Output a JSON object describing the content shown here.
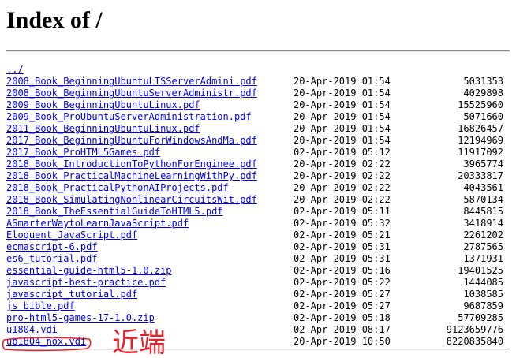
{
  "page": {
    "title": "Index of /",
    "parent_link": "../"
  },
  "files": [
    {
      "name": "2008_Book_BeginningUbuntuLTSServerAdmini.pdf",
      "date": "20-Apr-2019 01:54",
      "size": "5031353"
    },
    {
      "name": "2008_Book_BeginningUbuntuServerAdministr.pdf",
      "date": "20-Apr-2019 01:54",
      "size": "4029898"
    },
    {
      "name": "2009_Book_BeginningUbuntuLinux.pdf",
      "date": "20-Apr-2019 01:54",
      "size": "15525960"
    },
    {
      "name": "2009_Book_ProUbuntuServerAdministration.pdf",
      "date": "20-Apr-2019 01:54",
      "size": "5071660"
    },
    {
      "name": "2011_Book_BeginningUbuntuLinux.pdf",
      "date": "20-Apr-2019 01:54",
      "size": "16826457"
    },
    {
      "name": "2017_Book_BeginningUbuntuForWindowsAndMa.pdf",
      "date": "20-Apr-2019 01:54",
      "size": "12194969"
    },
    {
      "name": "2017_Book_ProHTML5Games.pdf",
      "date": "02-Apr-2019 05:12",
      "size": "11917092"
    },
    {
      "name": "2018_Book_IntroductionToPythonForEnginee.pdf",
      "date": "20-Apr-2019 02:22",
      "size": "3965774"
    },
    {
      "name": "2018_Book_PracticalMachineLearningWithPy.pdf",
      "date": "20-Apr-2019 02:22",
      "size": "20333817"
    },
    {
      "name": "2018_Book_PracticalPythonAIProjects.pdf",
      "date": "20-Apr-2019 02:22",
      "size": "4043561"
    },
    {
      "name": "2018_Book_SimulatingNonlinearCircuitsWit.pdf",
      "date": "20-Apr-2019 02:22",
      "size": "5870134"
    },
    {
      "name": "2018_Book_TheEssentialGuideToHTML5.pdf",
      "date": "02-Apr-2019 05:11",
      "size": "8445815"
    },
    {
      "name": "ASmarterWaytoLearnJavaScript.pdf",
      "date": "02-Apr-2019 05:32",
      "size": "3418914"
    },
    {
      "name": "Eloquent_JavaScript.pdf",
      "date": "02-Apr-2019 05:21",
      "size": "2261202"
    },
    {
      "name": "ecmascript-6.pdf",
      "date": "02-Apr-2019 05:31",
      "size": "2787565"
    },
    {
      "name": "es6_tutorial.pdf",
      "date": "02-Apr-2019 05:31",
      "size": "1371931"
    },
    {
      "name": "essential-guide-html5-1.0.zip",
      "date": "02-Apr-2019 05:16",
      "size": "19401525"
    },
    {
      "name": "javascript-best-practice.pdf",
      "date": "02-Apr-2019 05:22",
      "size": "1444085"
    },
    {
      "name": "javascript_tutorial.pdf",
      "date": "02-Apr-2019 05:27",
      "size": "1038585"
    },
    {
      "name": "js_bible.pdf",
      "date": "02-Apr-2019 05:27",
      "size": "9687859"
    },
    {
      "name": "pro-html5-games-17-1.0.zip",
      "date": "02-Apr-2019 05:18",
      "size": "57709285"
    },
    {
      "name": "u1804.vdi",
      "date": "02-Apr-2019 08:17",
      "size": "9123659776"
    },
    {
      "name": "ub1804_nox.vdi",
      "date": "20-Apr-2019 10:50",
      "size": "8220835840"
    }
  ],
  "annotation": {
    "text": "近端",
    "color": "#e8202a"
  }
}
